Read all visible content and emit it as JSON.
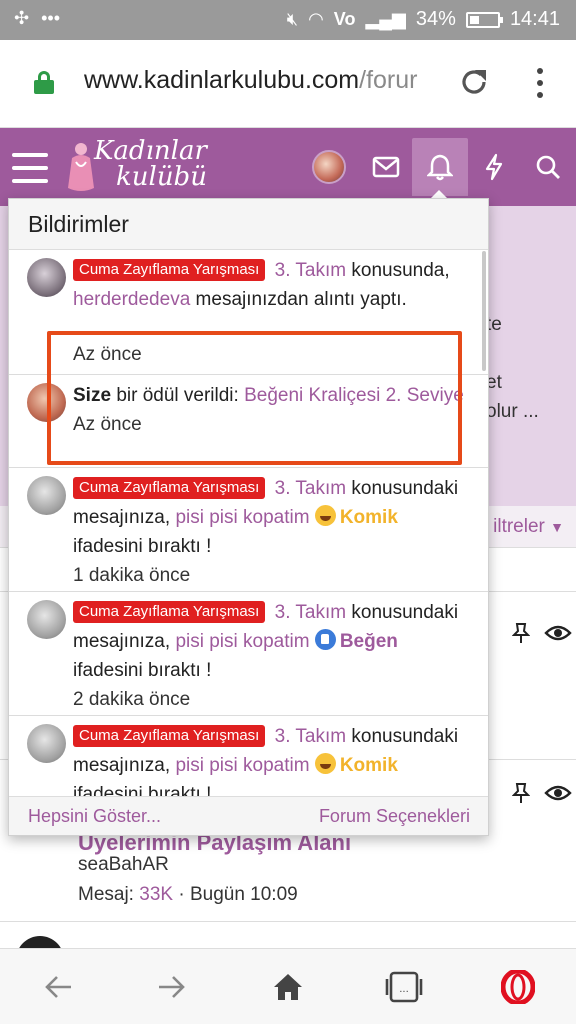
{
  "statusbar": {
    "battery": "34%",
    "time": "14:41",
    "network": "Vo"
  },
  "browser": {
    "url_domain": "www.kadinlarkulubu.com",
    "url_path": "/forur"
  },
  "site": {
    "logo_line1": "Kadınlar",
    "logo_line2": "kulübü"
  },
  "background": {
    "line1": "te",
    "line2": "et",
    "line3": "olur ...",
    "filters_label": "iltreler",
    "topic_title": "Üyelerimin Paylaşım Alanı",
    "topic_author": "seaBahAR",
    "topic_meta_prefix": "Mesaj:",
    "topic_meta_count": "33K",
    "topic_meta_suffix": "· Bugün 10:09"
  },
  "notifications": {
    "header": "Bildirimler",
    "items": [
      {
        "prefix": "Cuma Zayıflama Yarışması",
        "topic": "3. Takım",
        "t1": "konusunda,",
        "user": "herderdedeva",
        "t2": "mesajınızdan alıntı yaptı.",
        "time": "Az önce"
      },
      {
        "bold": "Size",
        "t1": "bir ödül verildi:",
        "award": "Beğeni Kraliçesi 2. Seviye",
        "time": "Az önce"
      },
      {
        "prefix": "Cuma Zayıflama Yarışması",
        "topic": "3. Takım",
        "t1": "konusundaki mesajınıza,",
        "user": "pisi pisi kopatim",
        "reaction": "Komik",
        "t2": "ifadesini bıraktı !",
        "time": "1 dakika önce"
      },
      {
        "prefix": "Cuma Zayıflama Yarışması",
        "topic": "3. Takım",
        "t1": "konusundaki mesajınıza,",
        "user": "pisi pisi kopatim",
        "reaction": "Beğen",
        "t2": "ifadesini bıraktı !",
        "time": "2 dakika önce"
      },
      {
        "prefix": "Cuma Zayıflama Yarışması",
        "topic": "3. Takım",
        "t1": "konusundaki mesajınıza,",
        "user": "pisi pisi kopatim",
        "reaction": "Komik",
        "t2": "ifadesini bıraktı !",
        "time": ""
      }
    ],
    "footer_left": "Hepsini Göster...",
    "footer_right": "Forum Seçenekleri"
  },
  "colors": {
    "brand": "#9e5a9c",
    "badge": "#e02020",
    "highlight": "#e64a19"
  }
}
